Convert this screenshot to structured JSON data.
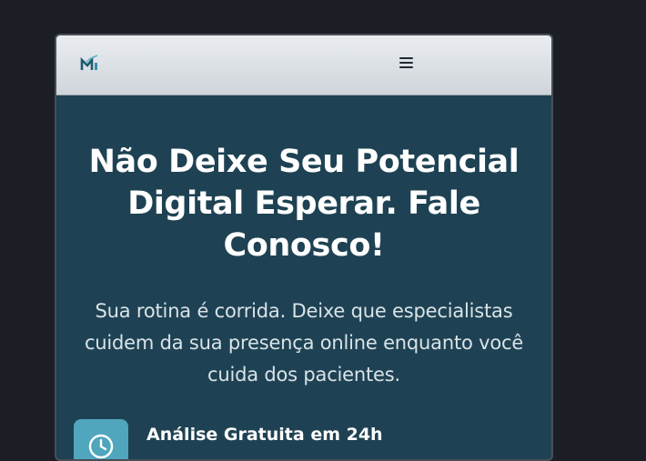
{
  "colors": {
    "page_background": "#1b1e25",
    "navbar_gradient_top": "#eaedf0",
    "navbar_gradient_bottom": "#cfd5db",
    "hero_background": "#1e4253",
    "accent": "#4fa6bd",
    "heading_text": "#ffffff",
    "body_text": "#d9e3e8"
  },
  "navbar": {
    "logo_icon": "bar-chart-logo-icon",
    "menu_icon": "hamburger-menu-icon"
  },
  "hero": {
    "heading_line1": "Não Deixe Seu Potencial",
    "heading_line2": "Digital Esperar. Fale",
    "heading_line3": "Conosco!",
    "description_line1": "Sua rotina é corrida. Deixe que especialistas",
    "description_line2": "cuidem da sua presença online enquanto você",
    "description_line3": "cuida dos pacientes."
  },
  "features": [
    {
      "icon": "clock-icon",
      "title": "Análise Gratuita em 24h"
    }
  ]
}
